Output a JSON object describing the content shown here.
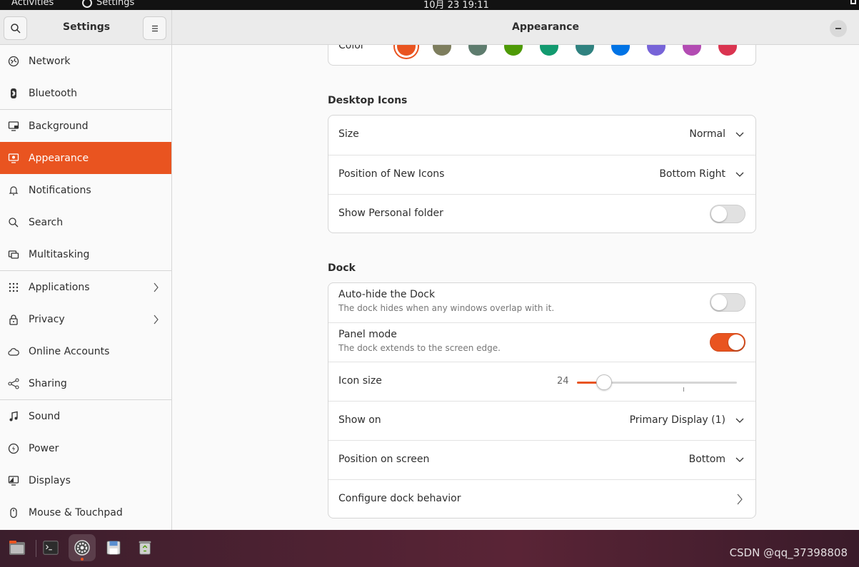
{
  "topbar": {
    "activities": "Activities",
    "app_name": "Settings",
    "clock": "10月 23  19:11"
  },
  "header": {
    "sidebar_title": "Settings",
    "page_title": "Appearance"
  },
  "sidebar": {
    "items": [
      {
        "label": "Network",
        "icon": "network-icon"
      },
      {
        "label": "Bluetooth",
        "icon": "bluetooth-icon"
      },
      {
        "label": "Background",
        "icon": "background-icon"
      },
      {
        "label": "Appearance",
        "icon": "appearance-icon",
        "active": true
      },
      {
        "label": "Notifications",
        "icon": "bell-icon"
      },
      {
        "label": "Search",
        "icon": "search-icon"
      },
      {
        "label": "Multitasking",
        "icon": "multitasking-icon"
      },
      {
        "label": "Applications",
        "icon": "apps-grid-icon",
        "has_arrow": true
      },
      {
        "label": "Privacy",
        "icon": "lock-icon",
        "has_arrow": true
      },
      {
        "label": "Online Accounts",
        "icon": "cloud-icon"
      },
      {
        "label": "Sharing",
        "icon": "share-icon"
      },
      {
        "label": "Sound",
        "icon": "music-note-icon"
      },
      {
        "label": "Power",
        "icon": "power-icon"
      },
      {
        "label": "Displays",
        "icon": "display-icon"
      },
      {
        "label": "Mouse & Touchpad",
        "icon": "mouse-icon"
      }
    ]
  },
  "appearance": {
    "color_label": "Color",
    "colors": [
      "#e95420",
      "#7e7e5e",
      "#5e7c6e",
      "#4e9a06",
      "#129a6f",
      "#308280",
      "#0073e5",
      "#7764d8",
      "#b34cb3",
      "#da3450"
    ],
    "selected_color": "#e95420"
  },
  "desktop_icons": {
    "title": "Desktop Icons",
    "size_label": "Size",
    "size_value": "Normal",
    "position_label": "Position of New Icons",
    "position_value": "Bottom Right",
    "personal_folder_label": "Show Personal folder",
    "personal_folder_on": false
  },
  "dock": {
    "title": "Dock",
    "autohide_label": "Auto-hide the Dock",
    "autohide_desc": "The dock hides when any windows overlap with it.",
    "autohide_on": false,
    "panel_label": "Panel mode",
    "panel_desc": "The dock extends to the screen edge.",
    "panel_on": true,
    "icon_size_label": "Icon size",
    "icon_size_value": "24",
    "icon_size_fraction": 0.17,
    "show_on_label": "Show on",
    "show_on_value": "Primary Display (1)",
    "position_label": "Position on screen",
    "position_value": "Bottom",
    "configure_label": "Configure dock behavior"
  },
  "taskbar": {
    "apps": [
      "files-icon",
      "terminal-icon",
      "settings-gear-icon",
      "save-disk-icon",
      "trash-recycle-icon"
    ],
    "watermark": "CSDN @qq_37398808"
  }
}
